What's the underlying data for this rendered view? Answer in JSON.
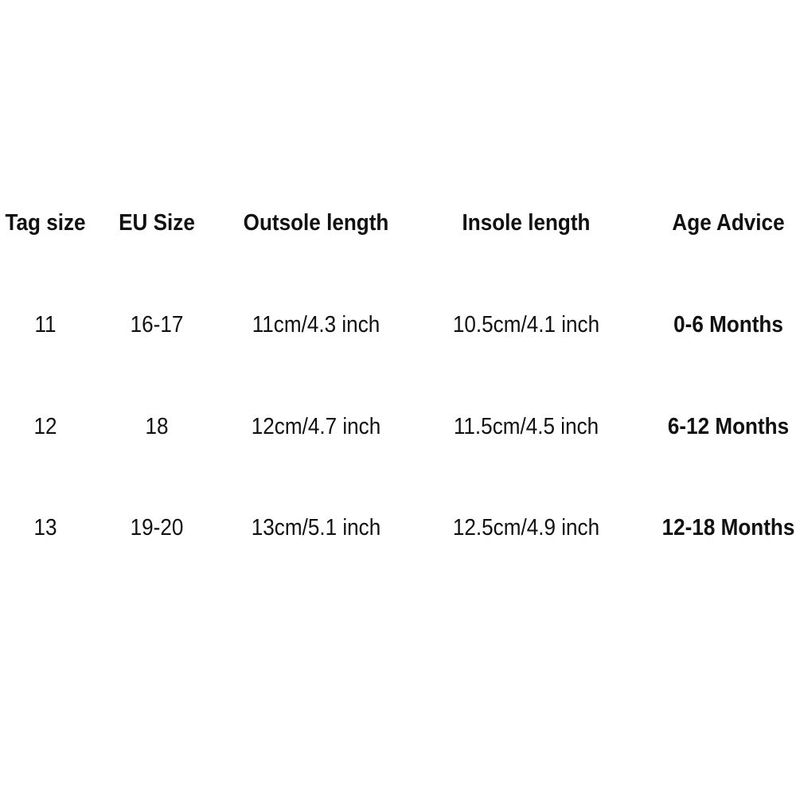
{
  "table": {
    "headers": [
      "Tag size",
      "EU Size",
      "Outsole length",
      "Insole length",
      "Age Advice"
    ],
    "rows": [
      [
        "11",
        "16-17",
        "11cm/4.3 inch",
        "10.5cm/4.1 inch",
        "0-6 Months"
      ],
      [
        "12",
        "18",
        "12cm/4.7 inch",
        "11.5cm/4.5 inch",
        "6-12 Months"
      ],
      [
        "13",
        "19-20",
        "13cm/5.1 inch",
        "12.5cm/4.9 inch",
        "12-18 Months"
      ]
    ]
  }
}
